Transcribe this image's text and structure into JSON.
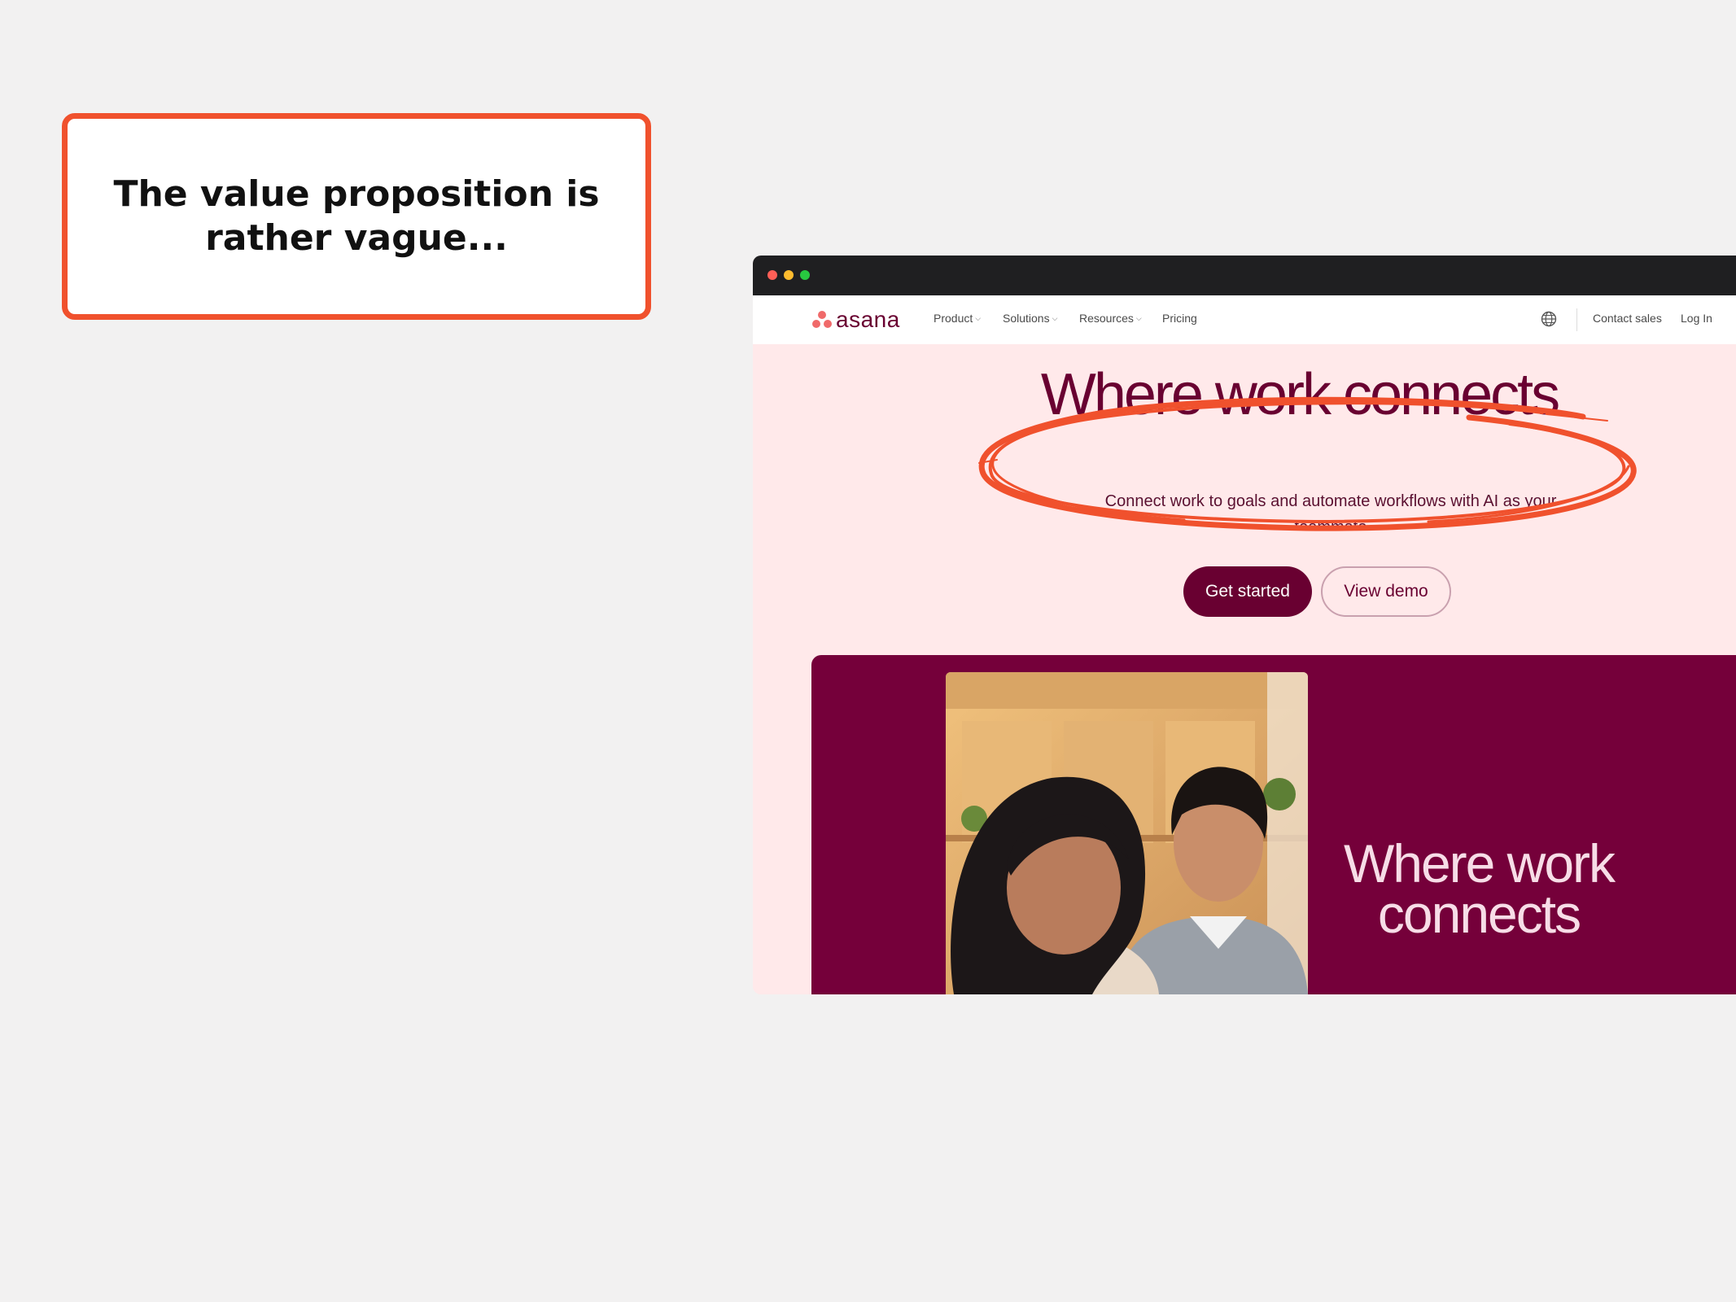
{
  "callout": {
    "text": "The value proposition is rather vague..."
  },
  "browser": {
    "nav": {
      "logo_text": "asana",
      "items": [
        {
          "label": "Product"
        },
        {
          "label": "Solutions"
        },
        {
          "label": "Resources"
        },
        {
          "label": "Pricing"
        }
      ],
      "contact_label": "Contact sales",
      "login_label": "Log In"
    },
    "hero": {
      "title": "Where work connects",
      "subtitle": "Connect work to goals and automate workflows with AI as your teammate",
      "primary_button": "Get started",
      "secondary_button": "View demo"
    },
    "video": {
      "title": "Where work connects"
    }
  },
  "colors": {
    "brand": "#690031",
    "annotation": "#f0512d",
    "hero_bg": "#ffe9ea",
    "logo": "#f06a6a"
  }
}
